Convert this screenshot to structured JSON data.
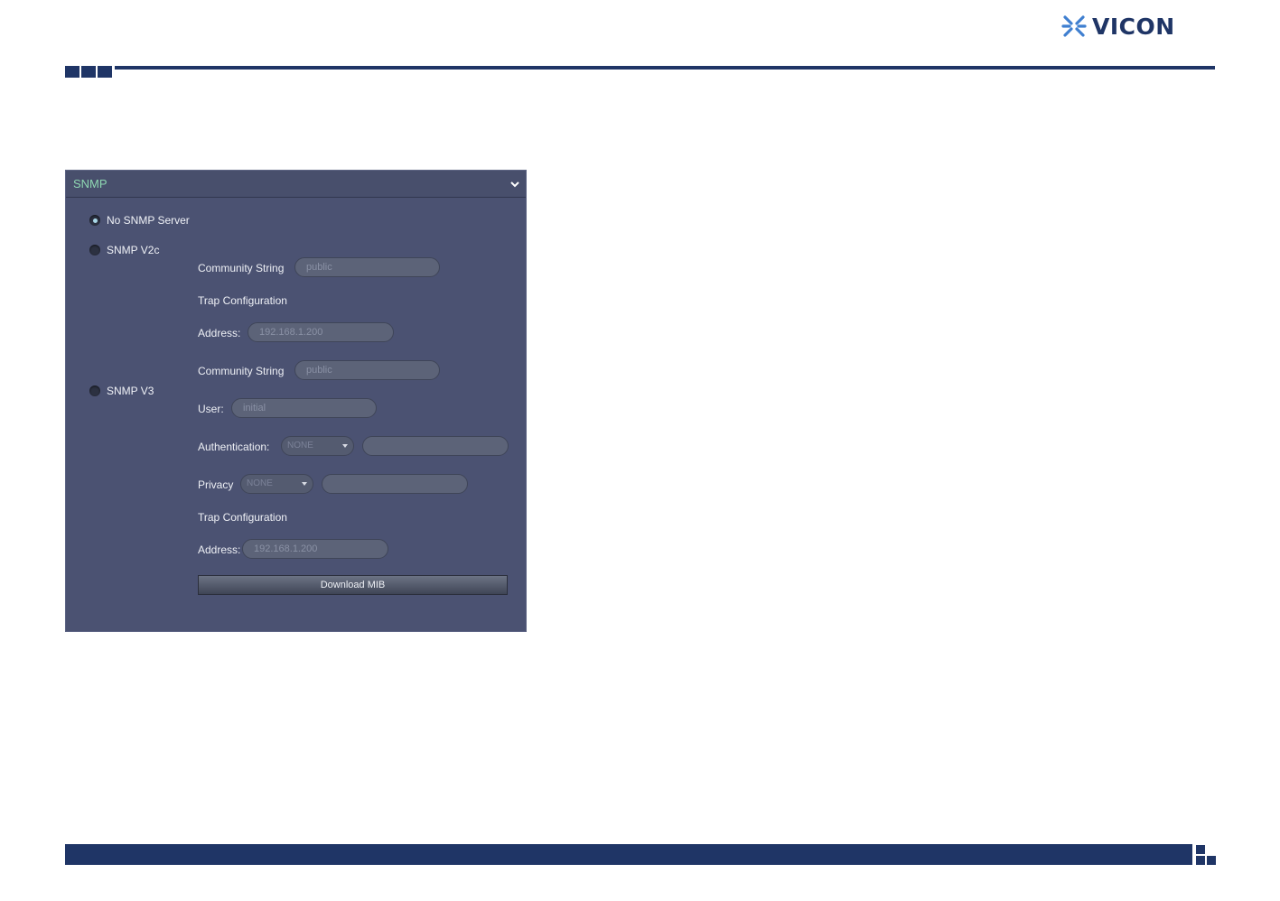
{
  "brand": {
    "name": "VICON",
    "color": "#1f3566"
  },
  "panel": {
    "title": "SNMP",
    "collapse_icon": "chevron-down-icon",
    "title_color": "#8ed7b2"
  },
  "options": {
    "no_snmp": {
      "label": "No SNMP Server",
      "selected": true
    },
    "v2c": {
      "label": "SNMP V2c",
      "selected": false
    },
    "v3": {
      "label": "SNMP V3",
      "selected": false
    }
  },
  "v2c": {
    "community_label": "Community String",
    "community_value": "public",
    "trap_heading": "Trap Configuration",
    "address_label": "Address:",
    "address_value": "192.168.1.200"
  },
  "v3": {
    "community_label": "Community String",
    "community_value": "public",
    "user_label": "User:",
    "user_value": "initial",
    "auth_label": "Authentication:",
    "auth_selected": "NONE",
    "auth_value": "",
    "privacy_label": "Privacy",
    "privacy_selected": "NONE",
    "privacy_value": "",
    "trap_heading": "Trap Configuration",
    "address_label": "Address:",
    "address_value": "192.168.1.200"
  },
  "download_button": {
    "label": "Download MIB"
  }
}
